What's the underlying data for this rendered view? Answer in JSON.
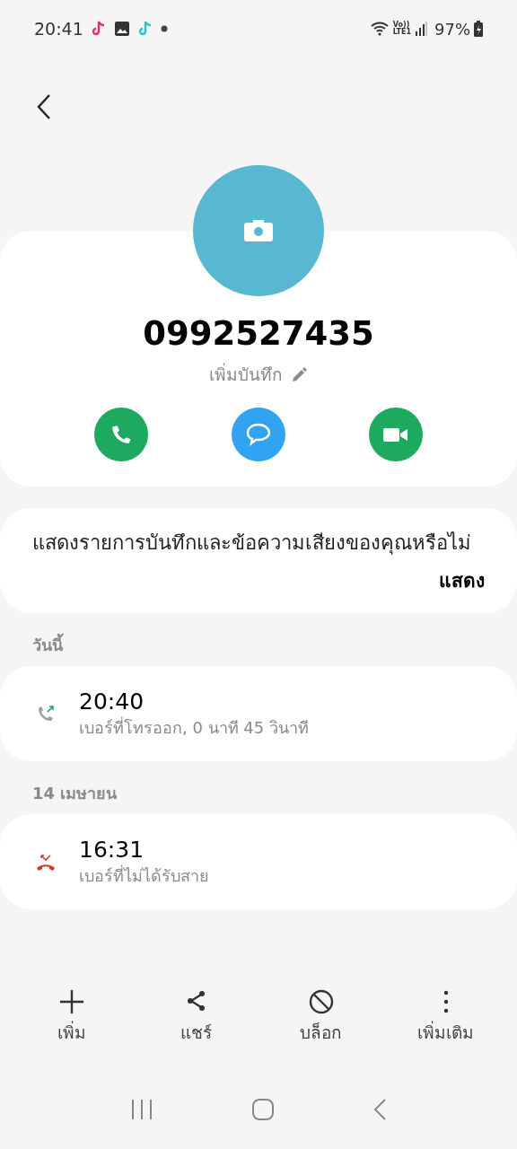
{
  "status_bar": {
    "time": "20:41",
    "volte": "Vo))",
    "network": "LTE1",
    "battery": "97%"
  },
  "contact": {
    "number": "0992527435",
    "note_link": "เพิ่มบันทึก"
  },
  "recording_prompt": {
    "message": "แสดงรายการบันทึกและข้อความเสียงของคุณหรือไม่",
    "action": "แสดง"
  },
  "call_groups": [
    {
      "date": "วันนี้",
      "calls": [
        {
          "kind": "outgoing",
          "time": "20:40",
          "detail": "เบอร์ที่โทรออก, 0 นาที 45 วินาที"
        }
      ]
    },
    {
      "date": "14 เมษายน",
      "calls": [
        {
          "kind": "missed",
          "time": "16:31",
          "detail": "เบอร์ที่ไม่ได้รับสาย"
        }
      ]
    }
  ],
  "actions": [
    {
      "kind": "add",
      "label": "เพิ่ม"
    },
    {
      "kind": "share",
      "label": "แชร์"
    },
    {
      "kind": "block",
      "label": "บล็อก"
    },
    {
      "kind": "more",
      "label": "เพิ่มเติม"
    }
  ]
}
